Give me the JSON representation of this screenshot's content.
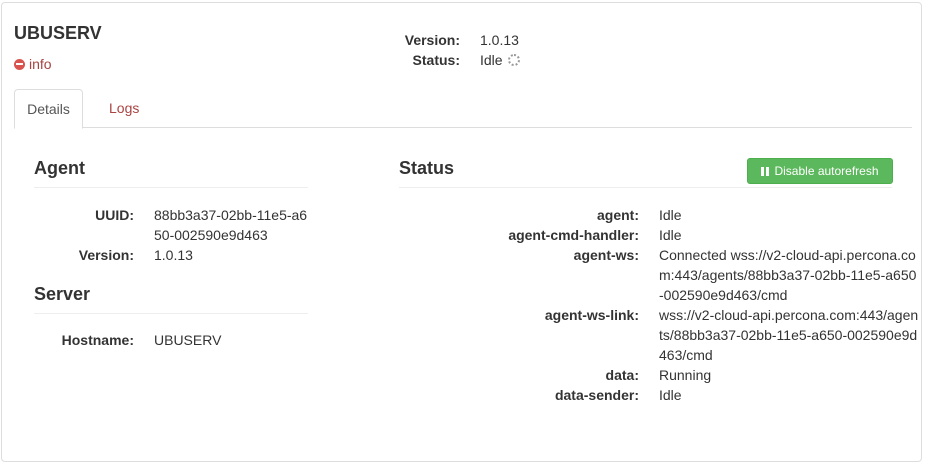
{
  "header": {
    "hostname": "UBUSERV",
    "info_label": "info",
    "version_label": "Version:",
    "version_value": "1.0.13",
    "status_label": "Status:",
    "status_value": "Idle"
  },
  "tabs": [
    {
      "label": "Details",
      "active": true
    },
    {
      "label": "Logs",
      "active": false
    }
  ],
  "agent": {
    "title": "Agent",
    "rows": [
      {
        "key": "UUID:",
        "value": "88bb3a37-02bb-11e5-a650-002590e9d463"
      },
      {
        "key": "Version:",
        "value": "1.0.13"
      }
    ]
  },
  "server": {
    "title": "Server",
    "rows": [
      {
        "key": "Hostname:",
        "value": "UBUSERV"
      }
    ]
  },
  "status": {
    "title": "Status",
    "button_label": "Disable autorefresh",
    "rows": [
      {
        "key": "agent:",
        "value": "Idle"
      },
      {
        "key": "agent-cmd-handler:",
        "value": "Idle"
      },
      {
        "key": "agent-ws:",
        "value": "Connected wss://v2-cloud-api.percona.com:443/agents/88bb3a37-02bb-11e5-a650-002590e9d463/cmd"
      },
      {
        "key": "agent-ws-link:",
        "value": "wss://v2-cloud-api.percona.com:443/agents/88bb3a37-02bb-11e5-a650-002590e9d463/cmd"
      },
      {
        "key": "data:",
        "value": "Running"
      },
      {
        "key": "data-sender:",
        "value": "Idle"
      }
    ]
  },
  "colors": {
    "link": "#a94442",
    "success": "#5cb85c",
    "border": "#dddddd"
  }
}
